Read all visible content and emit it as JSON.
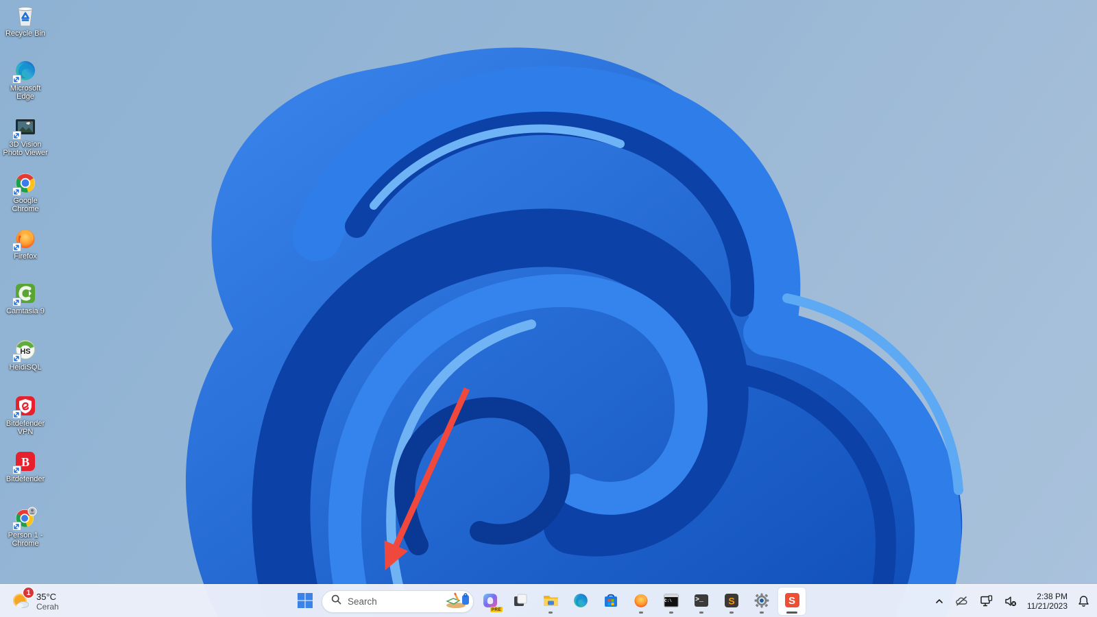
{
  "desktop": {
    "icons": [
      {
        "label": "Recycle Bin",
        "icon": "recycle-bin-icon",
        "shortcut": false
      },
      {
        "label": "Microsoft Edge",
        "icon": "edge-icon",
        "shortcut": true
      },
      {
        "label": "3D Vision Photo Viewer",
        "icon": "3d-vision-photo-viewer-icon",
        "shortcut": true
      },
      {
        "label": "Google Chrome",
        "icon": "chrome-icon",
        "shortcut": true
      },
      {
        "label": "Firefox",
        "icon": "firefox-icon",
        "shortcut": true
      },
      {
        "label": "Camtasia 9",
        "icon": "camtasia-icon",
        "shortcut": true
      },
      {
        "label": "HeidiSQL",
        "icon": "heidisql-icon",
        "shortcut": true,
        "glyph": "HS"
      },
      {
        "label": "Bitdefender VPN",
        "icon": "bitdefender-vpn-icon",
        "shortcut": true
      },
      {
        "label": "Bitdefender",
        "icon": "bitdefender-icon",
        "shortcut": true,
        "glyph": "B"
      },
      {
        "label": "Person 1 - Chrome",
        "icon": "chrome-profile-icon",
        "shortcut": true
      }
    ]
  },
  "annotation": {
    "type": "red-arrow",
    "color": "#f0483c",
    "points_to": "taskbar-search"
  },
  "taskbar": {
    "widget": {
      "badge_count": "1",
      "temperature": "35°C",
      "condition": "Cerah",
      "icon": "weather-sun-cloud-icon"
    },
    "start": {
      "icon": "windows-start-icon"
    },
    "search": {
      "placeholder": "Search",
      "icon": "search-icon",
      "highlight_icon": "search-highlight-illustration"
    },
    "apps": [
      {
        "name": "copilot",
        "running": false,
        "badge": "PRE"
      },
      {
        "name": "task-view",
        "running": false
      },
      {
        "name": "file-explorer",
        "running": true
      },
      {
        "name": "edge",
        "running": false
      },
      {
        "name": "microsoft-store",
        "running": false
      },
      {
        "name": "firefox",
        "running": true
      },
      {
        "name": "command-prompt",
        "running": true,
        "glyph": "C:\\"
      },
      {
        "name": "terminal",
        "running": true,
        "glyph": ">_"
      },
      {
        "name": "sublime-text",
        "running": true,
        "glyph": "S"
      },
      {
        "name": "settings",
        "running": true
      },
      {
        "name": "snagit",
        "running": true,
        "active": true,
        "glyph": "S"
      }
    ],
    "tray": {
      "chevron": "hidden-icons",
      "icons": [
        "onedrive-offline-icon",
        "network-ethernet-icon",
        "volume-muted-icon"
      ],
      "time": "2:38 PM",
      "date": "11/21/2023",
      "bell": "notifications-bell-icon"
    }
  },
  "colors": {
    "taskbar_bg": "#ebf0fa",
    "accent_blue": "#2f7ce6",
    "wallpaper_bloom": "#1f6be0",
    "badge_red": "#d83636",
    "arrow_red": "#f0483c"
  }
}
